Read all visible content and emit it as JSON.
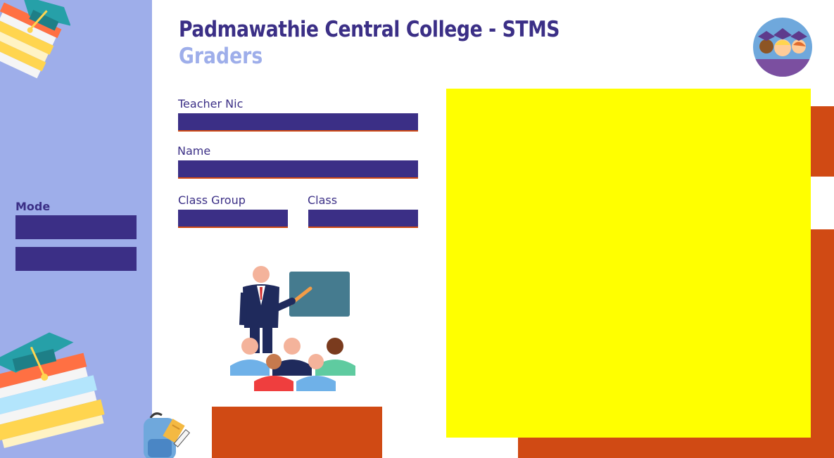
{
  "header": {
    "title": "Padmawathie Central College - STMS",
    "subtitle": "Graders"
  },
  "sidebar": {
    "mode_label": "Mode",
    "mode_buttons": [
      "",
      ""
    ]
  },
  "form": {
    "teacher_nic": {
      "label": "Teacher Nic",
      "value": ""
    },
    "name": {
      "label": "Name",
      "value": ""
    },
    "class_group": {
      "label": "Class Group",
      "value": ""
    },
    "class": {
      "label": "Class",
      "value": ""
    }
  },
  "colors": {
    "primary": "#3b2f86",
    "sidebar": "#9eaeea",
    "accent": "#d04a14",
    "highlight": "#ffff00"
  },
  "icons": [
    "books-graduation-cap-icon",
    "students-avatar-icon",
    "teacher-classroom-icon",
    "backpack-icon"
  ]
}
